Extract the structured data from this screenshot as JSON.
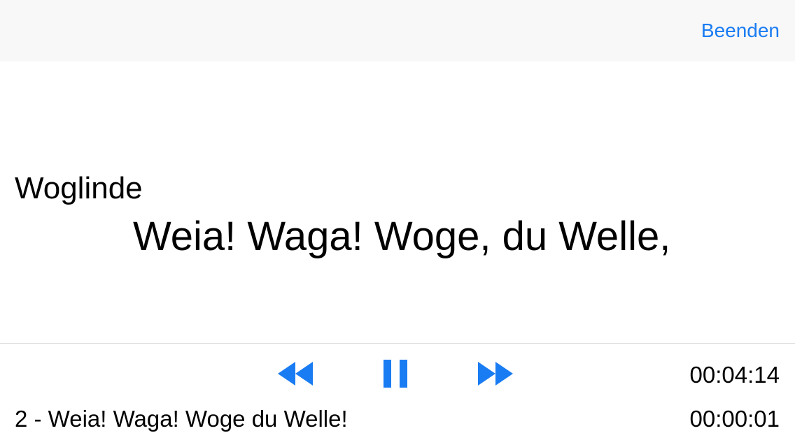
{
  "navbar": {
    "done_label": "Beenden"
  },
  "libretto": {
    "speaker": "Woglinde",
    "line": "Weia! Waga! Woge, du Welle,"
  },
  "player": {
    "controls": {
      "rewind_icon": "rewind-icon",
      "pause_icon": "pause-icon",
      "forward_icon": "fast-forward-icon"
    },
    "total_time": "00:04:14",
    "elapsed_time": "00:00:01",
    "track_title": "2 - Weia! Waga! Woge du Welle!"
  },
  "colors": {
    "accent": "#1a7cf2",
    "topbar_bg": "#f8f8f8",
    "divider": "#d9d9d9"
  }
}
